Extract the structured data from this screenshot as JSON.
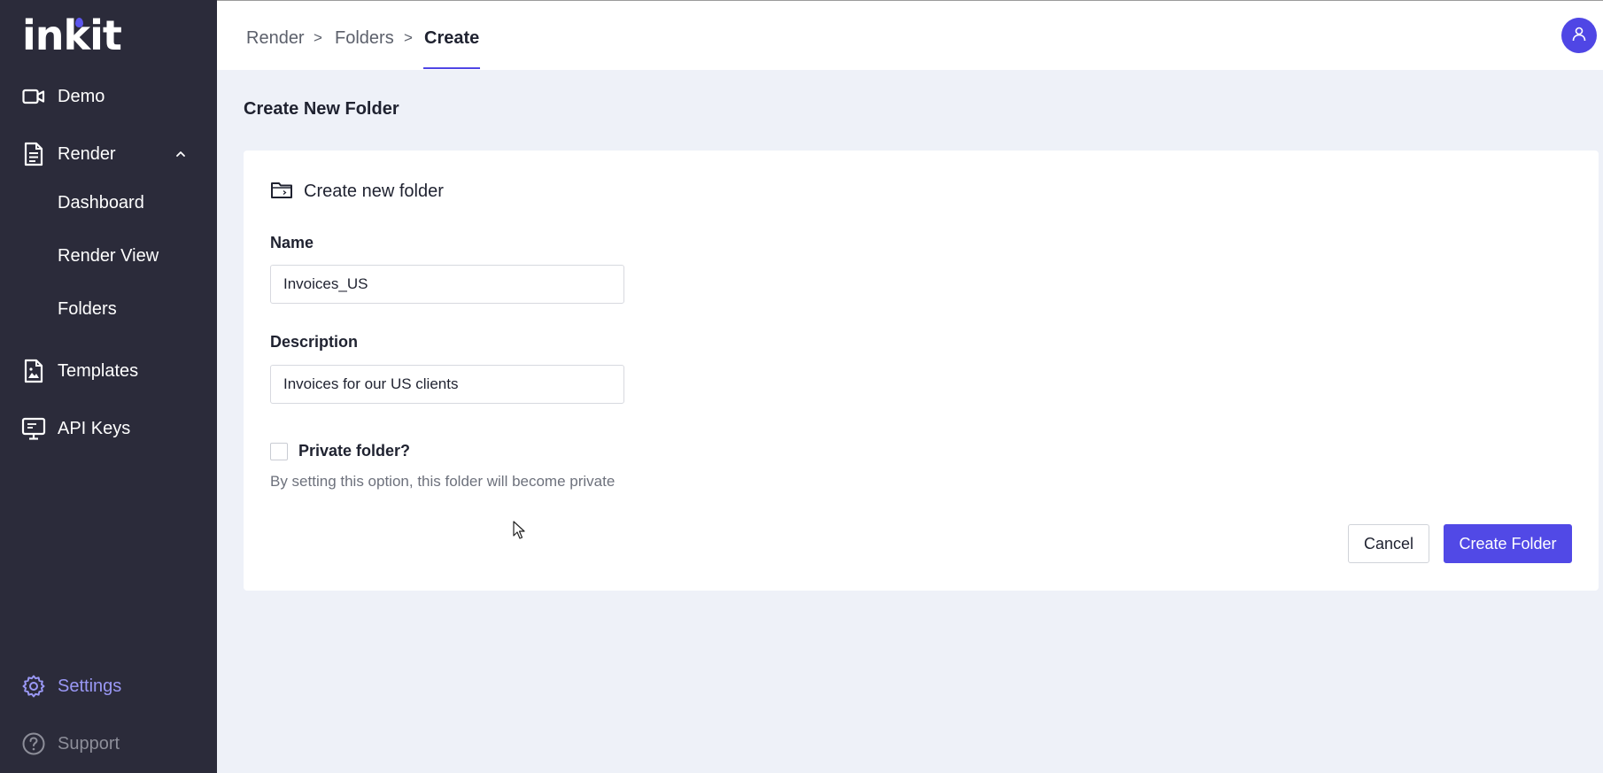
{
  "app": {
    "logo_text": "inkit"
  },
  "sidebar": {
    "items": [
      {
        "label": "Demo",
        "icon": "video-camera-icon"
      },
      {
        "label": "Render",
        "icon": "document-icon",
        "expanded": true
      },
      {
        "label": "Dashboard"
      },
      {
        "label": "Render View"
      },
      {
        "label": "Folders"
      },
      {
        "label": "Templates",
        "icon": "image-file-icon"
      },
      {
        "label": "API Keys",
        "icon": "monitor-icon"
      }
    ],
    "footer": [
      {
        "label": "Settings",
        "icon": "gear-icon"
      },
      {
        "label": "Support",
        "icon": "help-circle-icon"
      }
    ]
  },
  "breadcrumb": {
    "items": [
      "Render",
      "Folders",
      "Create"
    ],
    "separator": ">"
  },
  "user": {
    "icon": "user-icon"
  },
  "page": {
    "title": "Create New Folder",
    "card_title": "Create new folder",
    "name_label": "Name",
    "name_value": "Invoices_US",
    "description_label": "Description",
    "description_value": "Invoices for our US clients",
    "private_label": "Private folder?",
    "private_checked": false,
    "private_hint": "By setting this option, this folder will become private",
    "cancel_label": "Cancel",
    "create_label": "Create Folder"
  },
  "colors": {
    "accent": "#5149e6",
    "sidebar_bg": "#2b2b3a",
    "page_bg": "#eef1f8",
    "settings_highlight": "#9a98f5"
  }
}
